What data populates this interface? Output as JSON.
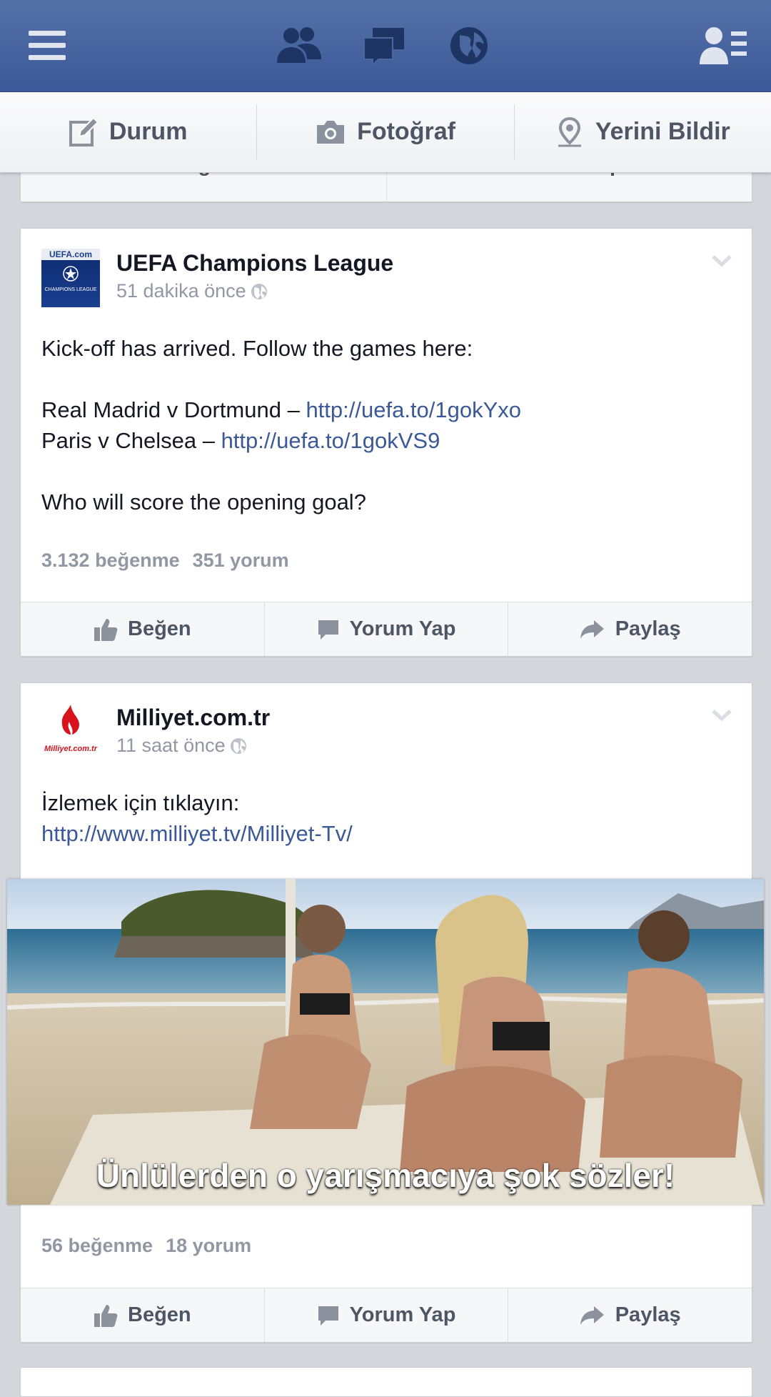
{
  "composer": {
    "status_label": "Durum",
    "photo_label": "Fotoğraf",
    "checkin_label": "Yerini Bildir"
  },
  "prev_card": {
    "like_label": "Beğen",
    "comment_label": "Yorum Yap"
  },
  "posts": [
    {
      "author": "UEFA Champions League",
      "avatar_text": "UEFA.com",
      "avatar_sub": "CHAMPIONS LEAGUE",
      "time": "51 dakika önce",
      "line1": "Kick-off has arrived. Follow the games here:",
      "line2_text": "Real Madrid v Dortmund – ",
      "line2_link": "http://uefa.to/1gokYxo",
      "line3_text": "Paris v Chelsea – ",
      "line3_link": "http://uefa.to/1gokVS9",
      "line4": "Who will score the opening goal?",
      "likes": "3.132 beğenme",
      "comments": "351 yorum",
      "like_label": "Beğen",
      "comment_label": "Yorum Yap",
      "share_label": "Paylaş"
    },
    {
      "author": "Milliyet.com.tr",
      "avatar_text": "Milliyet.com.tr",
      "time": "11 saat önce",
      "line1": "İzlemek için tıklayın:",
      "link": "http://www.milliyet.tv/Milliyet-Tv/",
      "photo_caption": "Ünlülerden o yarışmacıya şok sözler!",
      "likes": "56 beğenme",
      "comments": "18 yorum",
      "like_label": "Beğen",
      "comment_label": "Yorum Yap",
      "share_label": "Paylaş"
    }
  ],
  "colors": {
    "header": "#3b5998",
    "link": "#3b5998",
    "muted": "#9197a3",
    "background": "#d3d6db"
  },
  "icons": [
    "menu-icon",
    "friend-requests-icon",
    "messages-icon",
    "notifications-globe-icon",
    "friends-list-icon",
    "edit-icon",
    "camera-icon",
    "location-pin-icon",
    "like-icon",
    "comment-icon",
    "share-icon",
    "globe-icon",
    "chevron-down-icon"
  ]
}
